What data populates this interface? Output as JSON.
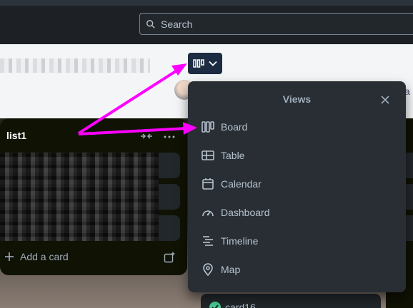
{
  "search": {
    "placeholder": "Search"
  },
  "board": {
    "view_switcher_icon": "board-icon"
  },
  "list": {
    "title": "list1",
    "add_card_label": "Add a card"
  },
  "visible_card": {
    "label": "card16"
  },
  "views_popover": {
    "title": "Views",
    "close_icon": "close-icon",
    "items": [
      {
        "label": "Board",
        "icon": "board-icon"
      },
      {
        "label": "Table",
        "icon": "table-icon"
      },
      {
        "label": "Calendar",
        "icon": "calendar-icon"
      },
      {
        "label": "Dashboard",
        "icon": "dashboard-icon"
      },
      {
        "label": "Timeline",
        "icon": "timeline-icon"
      },
      {
        "label": "Map",
        "icon": "map-pin-icon"
      }
    ]
  },
  "annotations": {
    "arrow_color": "#ff00ff"
  },
  "colors": {
    "topbar": "#1d2125",
    "popover_bg": "#282e33",
    "list_bg": "#101204",
    "text": "#b6c2cf",
    "switcher_bg": "#1c2b41"
  }
}
